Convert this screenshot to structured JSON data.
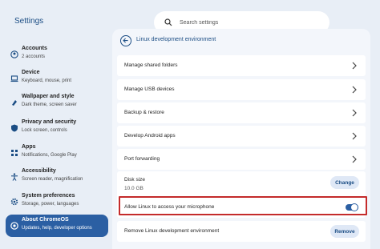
{
  "app": {
    "title": "Settings"
  },
  "search": {
    "placeholder": "Search settings"
  },
  "colors": {
    "accent": "#2b5fa3",
    "highlight": "#c42b2b",
    "sidebar_bg": "#e8eef6"
  },
  "sidebar": {
    "items": [
      {
        "title": "Accounts",
        "sub": "2 accounts",
        "icon": "account-icon"
      },
      {
        "title": "Device",
        "sub": "Keyboard, mouse, print",
        "icon": "laptop-icon"
      },
      {
        "title": "Wallpaper and style",
        "sub": "Dark theme, screen saver",
        "icon": "palette-icon"
      },
      {
        "title": "Privacy and security",
        "sub": "Lock screen, controls",
        "icon": "shield-icon"
      },
      {
        "title": "Apps",
        "sub": "Notifications, Google Play",
        "icon": "apps-grid-icon"
      },
      {
        "title": "Accessibility",
        "sub": "Screen reader, magnification",
        "icon": "accessibility-icon"
      },
      {
        "title": "System preferences",
        "sub": "Storage, power, languages",
        "icon": "gear-icon"
      },
      {
        "title": "About ChromeOS",
        "sub": "Updates, help, developer options",
        "icon": "chromeos-icon",
        "active": true
      }
    ]
  },
  "main": {
    "title": "Linux development environment",
    "rows": [
      {
        "label": "Manage shared folders"
      },
      {
        "label": "Manage USB devices"
      },
      {
        "label": "Backup & restore"
      },
      {
        "label": "Develop Android apps"
      },
      {
        "label": "Port forwarding"
      }
    ],
    "disk": {
      "label": "Disk size",
      "value": "10.0 GB",
      "button": "Change"
    },
    "mic": {
      "label": "Allow Linux to access your microphone",
      "enabled": true
    },
    "remove": {
      "label": "Remove Linux development environment",
      "button": "Remove"
    }
  }
}
